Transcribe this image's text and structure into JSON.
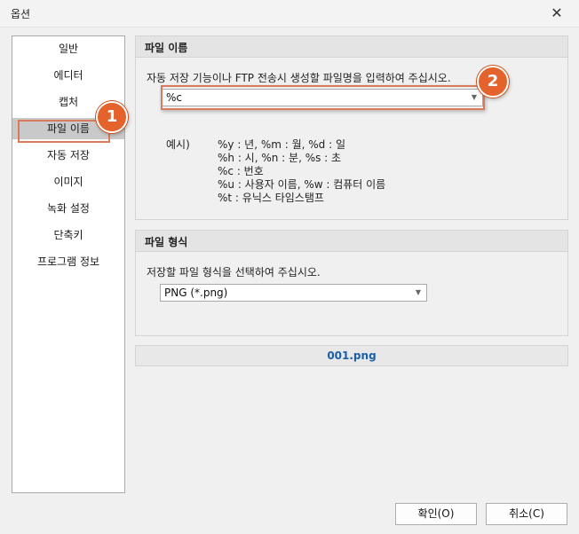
{
  "window": {
    "title": "옵션"
  },
  "sidebar": {
    "items": [
      {
        "label": "일반"
      },
      {
        "label": "에디터"
      },
      {
        "label": "캡처"
      },
      {
        "label": "파일 이름",
        "selected": true
      },
      {
        "label": "자동 저장"
      },
      {
        "label": "이미지"
      },
      {
        "label": "녹화 설정"
      },
      {
        "label": "단축키"
      },
      {
        "label": "프로그램 정보"
      }
    ]
  },
  "callouts": [
    "1",
    "2"
  ],
  "accent_color": "#e4622b",
  "filename_group": {
    "title": "파일 이름",
    "instruction": "자동 저장 기능이나 FTP 전송시 생성할 파일명을 입력하여 주십시오.",
    "pattern_value": "%c",
    "example_label": "예시)",
    "examples": [
      "%y : 년, %m : 월, %d : 일",
      "%h : 시, %n : 분, %s : 초",
      "%c : 번호",
      "%u : 사용자 이름, %w : 컴퓨터 이름",
      "%t : 유닉스 타임스탬프"
    ]
  },
  "format_group": {
    "title": "파일 형식",
    "instruction": "저장할 파일 형식을 선택하여 주십시오.",
    "selected_format": "PNG (*.png)"
  },
  "preview": {
    "filename": "001.png"
  },
  "buttons": {
    "ok": "확인(O)",
    "cancel": "취소(C)"
  }
}
